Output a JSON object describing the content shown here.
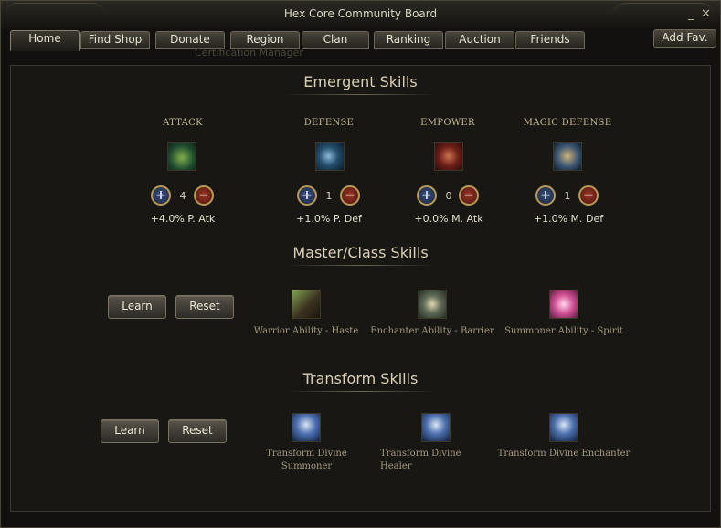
{
  "window": {
    "title": "Hex Core Community Board"
  },
  "titlebar": {
    "minimize_label": "_",
    "close_label": "✕"
  },
  "tabs": [
    {
      "label": "Home"
    },
    {
      "label": "Find Shop"
    },
    {
      "label": "Donate"
    },
    {
      "label": "Region"
    },
    {
      "label": "Clan"
    },
    {
      "label": "Ranking"
    },
    {
      "label": "Auction"
    },
    {
      "label": "Friends"
    }
  ],
  "add_fav_label": "Add Fav.",
  "ghost_text": "Certification Manager",
  "emergent": {
    "title": "Emergent Skills",
    "plus_symbol": "+",
    "minus_symbol": "−",
    "items": [
      {
        "category": "ATTACK",
        "value": "4",
        "bonus": "+4.0% P. Atk",
        "icon": "attack-skill-icon"
      },
      {
        "category": "DEFENSE",
        "value": "1",
        "bonus": "+1.0% P. Def",
        "icon": "defense-skill-icon"
      },
      {
        "category": "EMPOWER",
        "value": "0",
        "bonus": "+0.0% M. Atk",
        "icon": "empower-skill-icon"
      },
      {
        "category": "MAGIC DEFENSE",
        "value": "1",
        "bonus": "+1.0% M. Def",
        "icon": "magic-defense-skill-icon"
      }
    ]
  },
  "master": {
    "title": "Master/Class Skills",
    "learn_label": "Learn",
    "reset_label": "Reset",
    "skills": [
      {
        "name": "Warrior Ability - Haste",
        "icon": "haste-skill-icon"
      },
      {
        "name": "Enchanter Ability - Barrier",
        "icon": "barrier-skill-icon"
      },
      {
        "name": "Summoner Ability - Spirit",
        "icon": "spirit-skill-icon"
      }
    ]
  },
  "transform": {
    "title": "Transform Skills",
    "learn_label": "Learn",
    "reset_label": "Reset",
    "skills": [
      {
        "name": "Transform Divine Summoner",
        "icon": "divine-summoner-icon"
      },
      {
        "name": "Transform Divine Healer",
        "icon": "divine-healer-icon"
      },
      {
        "name": "Transform Divine Enchanter",
        "icon": "divine-enchanter-icon"
      }
    ]
  },
  "colors": {
    "accent_gold": "#b89a56",
    "text_light": "#e4dfd0",
    "title_text": "#d9cfb5",
    "panel_bg": "#181713"
  }
}
